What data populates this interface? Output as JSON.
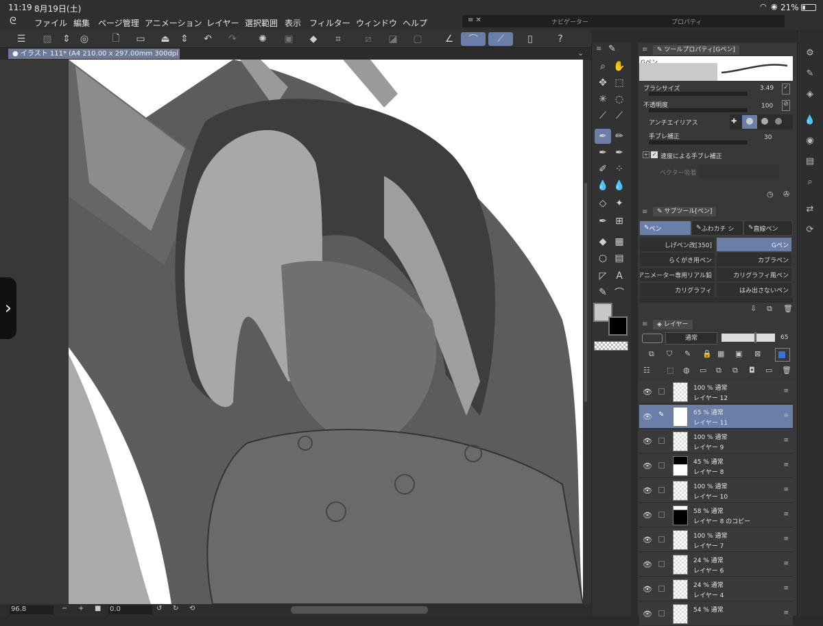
{
  "status": {
    "time": "11:19",
    "date": "8月19日(土)",
    "battery": "21%"
  },
  "menu": [
    "ファイル",
    "編集",
    "ページ管理",
    "アニメーション",
    "レイヤー",
    "選択範囲",
    "表示",
    "フィルター",
    "ウィンドウ",
    "ヘルプ"
  ],
  "navigator": {
    "title": "ナビゲーター",
    "props": "プロパティ"
  },
  "doc": {
    "tab": "イラスト 111* (A4 210.00 x 297.00mm 300dpi 96.8%)"
  },
  "bottom": {
    "zoom": "96.8",
    "angle": "0.0"
  },
  "toolprop": {
    "tab": "ツールプロパティ[Gペン]",
    "preset": "Gペン",
    "brush_size_label": "ブラシサイズ",
    "brush_size": "3.49",
    "opacity_label": "不透明度",
    "opacity": "100",
    "aa_label": "アンチエイリアス",
    "stab_label": "手ブレ補正",
    "stab": "30",
    "speed_label": "速度による手ブレ補正",
    "vector_label": "ベクター吸着"
  },
  "subtool": {
    "tab": "サブツール[ペン]",
    "tabs": [
      "ペン",
      "ふわカチ シ",
      "直線ペン"
    ],
    "items": [
      [
        "しげペン改[350]",
        "Gペン"
      ],
      [
        "らくがき用ペン",
        "カブラペン"
      ],
      [
        "アニメーター専用リアル鉛",
        "カリグラフィ風ペン"
      ],
      [
        "カリグラフィ",
        "はみ出さないペン"
      ]
    ]
  },
  "layerpanel": {
    "tab": "レイヤー",
    "blend": "通常",
    "opacity": "65"
  },
  "layers": [
    {
      "pct": "100 %",
      "mode": "通常",
      "name": "レイヤー 12"
    },
    {
      "pct": "65 %",
      "mode": "通常",
      "name": "レイヤー 11"
    },
    {
      "pct": "100 %",
      "mode": "通常",
      "name": "レイヤー 9"
    },
    {
      "pct": "45 %",
      "mode": "通常",
      "name": "レイヤー 8"
    },
    {
      "pct": "100 %",
      "mode": "通常",
      "name": "レイヤー 10"
    },
    {
      "pct": "58 %",
      "mode": "通常",
      "name": "レイヤー 8 のコピー"
    },
    {
      "pct": "100 %",
      "mode": "通常",
      "name": "レイヤー 7"
    },
    {
      "pct": "24 %",
      "mode": "通常",
      "name": "レイヤー 6"
    },
    {
      "pct": "24 %",
      "mode": "通常",
      "name": "レイヤー 4"
    },
    {
      "pct": "54 %",
      "mode": "通常",
      "name": ""
    }
  ]
}
